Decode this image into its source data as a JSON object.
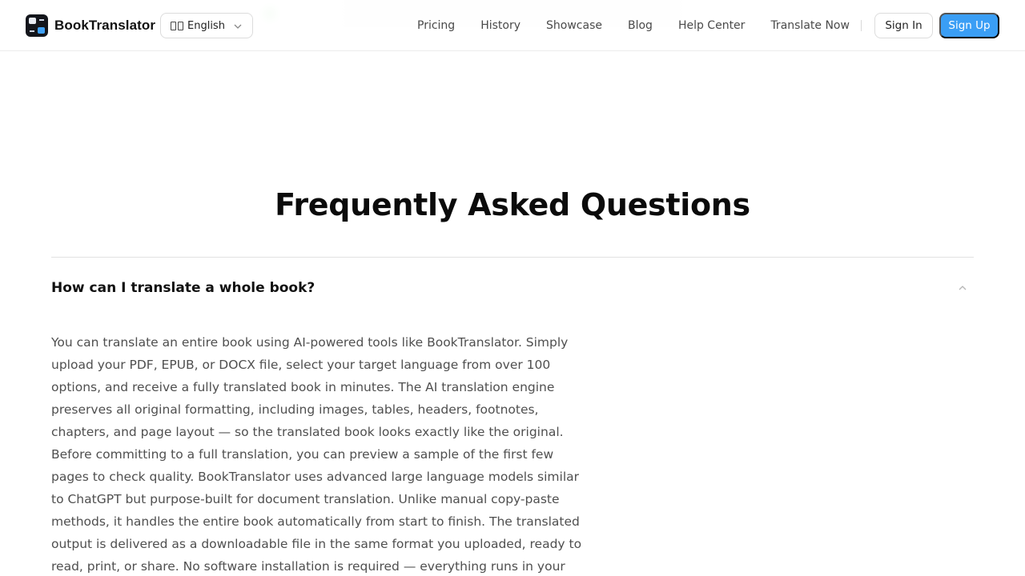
{
  "brand": {
    "name": "BookTranslator"
  },
  "language_selector": {
    "value": "English",
    "flag_icon": "flag-icon"
  },
  "nav": {
    "items": [
      {
        "label": "Pricing"
      },
      {
        "label": "History"
      },
      {
        "label": "Showcase"
      },
      {
        "label": "Blog"
      },
      {
        "label": "Help Center"
      },
      {
        "label": "Translate Now"
      }
    ]
  },
  "auth": {
    "sign_in": "Sign In",
    "sign_up": "Sign Up"
  },
  "colors": {
    "accent": "#3a9ef5",
    "logo_bg": "#14161c"
  },
  "faq": {
    "title": "Frequently Asked Questions",
    "items": [
      {
        "question": "How can I translate a whole book?",
        "expanded": true,
        "answer": "You can translate an entire book using AI-powered tools like BookTranslator. Simply upload your PDF, EPUB, or DOCX file, select your target language from over 100 options, and receive a fully translated book in minutes. The AI translation engine preserves all original formatting, including images, tables, headers, footnotes, chapters, and page layout — so the translated book looks exactly like the original. Before committing to a full translation, you can preview a sample of the first few pages to check quality. BookTranslator uses advanced large language models similar to ChatGPT but purpose-built for document translation. Unlike manual copy-paste methods, it handles the entire book automatically from start to finish. The translated output is delivered as a downloadable file in the same format you uploaded, ready to read, print, or share. No software installation is required — everything runs in your browser."
      }
    ]
  }
}
